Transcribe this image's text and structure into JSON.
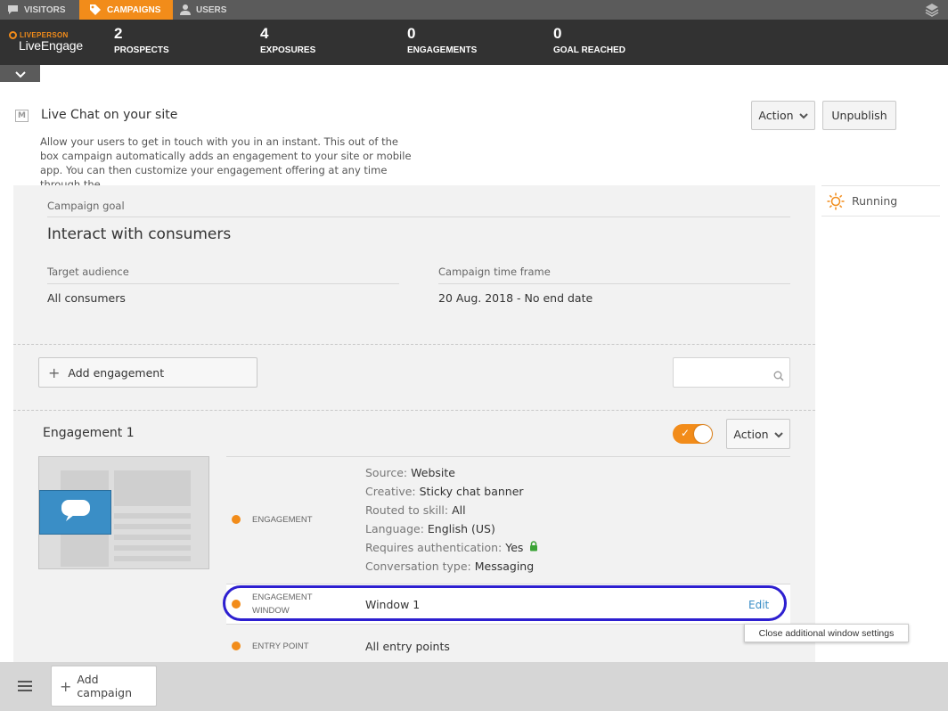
{
  "topbar": {
    "tabs": [
      {
        "label": "VISITORS",
        "icon": "chat-bubble-icon"
      },
      {
        "label": "CAMPAIGNS",
        "icon": "tag-icon",
        "active": true
      },
      {
        "label": "USERS",
        "icon": "user-icon"
      }
    ],
    "accent_color": "#f28c1a"
  },
  "brand": {
    "small": "LIVEPERSON",
    "name": "LiveEngage"
  },
  "stats": [
    {
      "value": "2",
      "label": "PROSPECTS"
    },
    {
      "value": "4",
      "label": "EXPOSURES"
    },
    {
      "value": "0",
      "label": "ENGAGEMENTS"
    },
    {
      "value": "0",
      "label": "GOAL REACHED"
    }
  ],
  "campaign": {
    "icon_letter": "M",
    "title": "Live Chat on your site",
    "description": "Allow your users to get in touch with you in an instant. This out of the box campaign automatically adds an engagement to your site or mobile app. You can then customize your engagement offering at any time through the",
    "action_label": "Action",
    "unpublish_label": "Unpublish",
    "status": "Running",
    "goal_label": "Campaign goal",
    "goal_value": "Interact with consumers",
    "audience_label": "Target audience",
    "audience_value": "All consumers",
    "timeframe_label": "Campaign time frame",
    "timeframe_value": "20 Aug. 2018 - No end date"
  },
  "engagements": {
    "add_label": "Add engagement",
    "search_placeholder": ""
  },
  "engagement": {
    "title": "Engagement 1",
    "enabled": true,
    "action_label": "Action",
    "section_engagement": "ENGAGEMENT",
    "details": {
      "source_k": "Source:",
      "source_v": "Website",
      "creative_k": "Creative:",
      "creative_v": "Sticky chat banner",
      "skill_k": "Routed to skill:",
      "skill_v": "All",
      "lang_k": "Language:",
      "lang_v": "English (US)",
      "auth_k": "Requires authentication:",
      "auth_v": "Yes",
      "conv_k": "Conversation type:",
      "conv_v": "Messaging"
    },
    "window_label_1": "ENGAGEMENT",
    "window_label_2": "WINDOW",
    "window_value": "Window 1",
    "edit_label": "Edit",
    "tooltip": "Close additional window settings",
    "entry_label": "ENTRY POINT",
    "entry_value": "All entry points"
  },
  "bottom": {
    "add_campaign_label": "Add campaign"
  }
}
